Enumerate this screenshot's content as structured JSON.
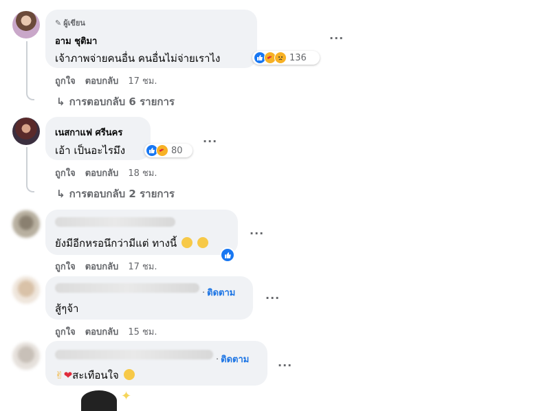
{
  "comments": [
    {
      "author_badge": "ผู้เขียน",
      "author": "อาม ชุติมา",
      "text": "เจ้าภาพจ่ายคนอื่น คนอื่นไม่จ่ายเราไง",
      "reaction_count": "136",
      "like_label": "ถูกใจ",
      "reply_label": "ตอบกลับ",
      "time": "17 ชม.",
      "replies_label": "การตอบกลับ 6 รายการ"
    },
    {
      "author": "เนสกาแฟ ศรีนคร",
      "text": "เอ้า เป็นอะไรมึง",
      "reaction_count": "80",
      "like_label": "ถูกใจ",
      "reply_label": "ตอบกลับ",
      "time": "18 ชม.",
      "replies_label": "การตอบกลับ 2 รายการ"
    },
    {
      "text": "ยังมีอีกหรอนึกว่ามีแต่ ทางนี้",
      "like_label": "ถูกใจ",
      "reply_label": "ตอบกลับ",
      "time": "17 ชม."
    },
    {
      "follow_label": "ติดตาม",
      "text": "สู้ๆจ้า",
      "like_label": "ถูกใจ",
      "reply_label": "ตอบกลับ",
      "time": "15 ชม."
    },
    {
      "follow_label": "ติดตาม",
      "text": "สะเทือนใจ"
    }
  ],
  "colors": {
    "bubble": "#f0f2f5",
    "meta": "#65676b",
    "link": "#1b74e4",
    "like_blue": "#1877f2"
  },
  "icons": {
    "more": "more-options-icon",
    "reply_arrow": "reply-arrow-icon",
    "badge": "pencil-icon"
  }
}
